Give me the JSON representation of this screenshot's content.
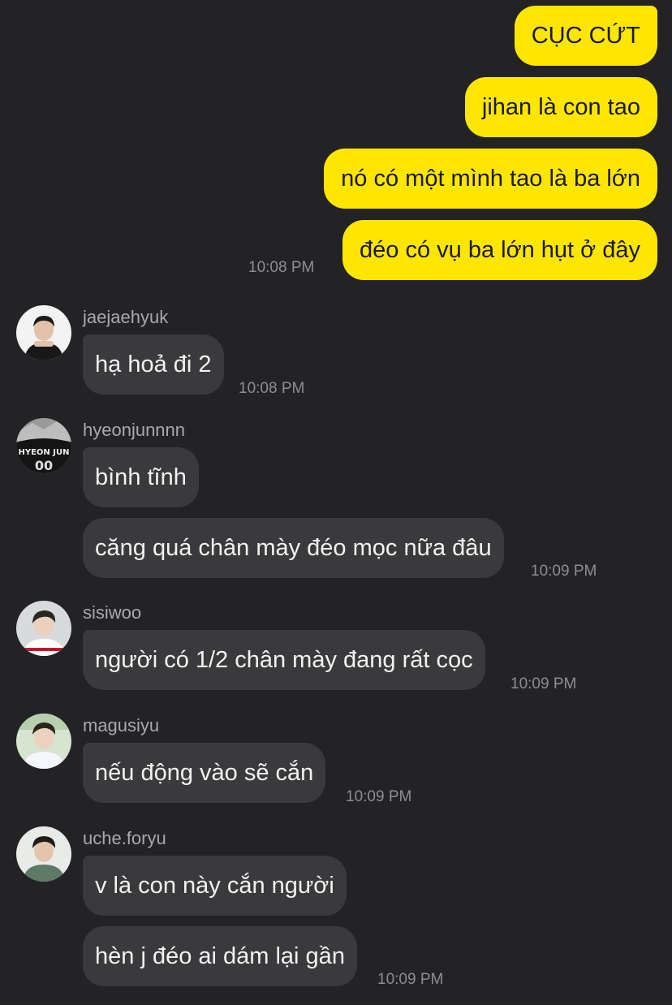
{
  "outgoing": [
    {
      "text": "CỤC CỨT"
    },
    {
      "text": "jihan là con tao"
    },
    {
      "text": "nó có một mình tao là ba lớn"
    },
    {
      "text": "đéo có vụ ba lớn hụt ở đây",
      "time": "10:08 PM"
    }
  ],
  "incoming": [
    {
      "sender": "jaejaehyuk",
      "messages": [
        "hạ hoả đi 2"
      ],
      "time": "10:08 PM"
    },
    {
      "sender": "hyeonjunnnn",
      "avatar_text": "HYEON JUN",
      "messages": [
        "bình tĩnh",
        "căng quá chân mày đéo mọc nữa đâu"
      ],
      "time": "10:09 PM"
    },
    {
      "sender": "sisiwoo",
      "messages": [
        "người có 1/2 chân mày đang rất cọc"
      ],
      "time": "10:09 PM"
    },
    {
      "sender": "magusiyu",
      "messages": [
        "nếu động vào sẽ cắn"
      ],
      "time": "10:09 PM"
    },
    {
      "sender": "uche.foryu",
      "messages": [
        "v là con này cắn người",
        "hèn j đéo ai dám lại gần"
      ],
      "time": "10:09 PM"
    }
  ],
  "colors": {
    "background": "#232325",
    "outgoing_bubble": "#FFE600",
    "incoming_bubble": "#3A3A3C"
  }
}
